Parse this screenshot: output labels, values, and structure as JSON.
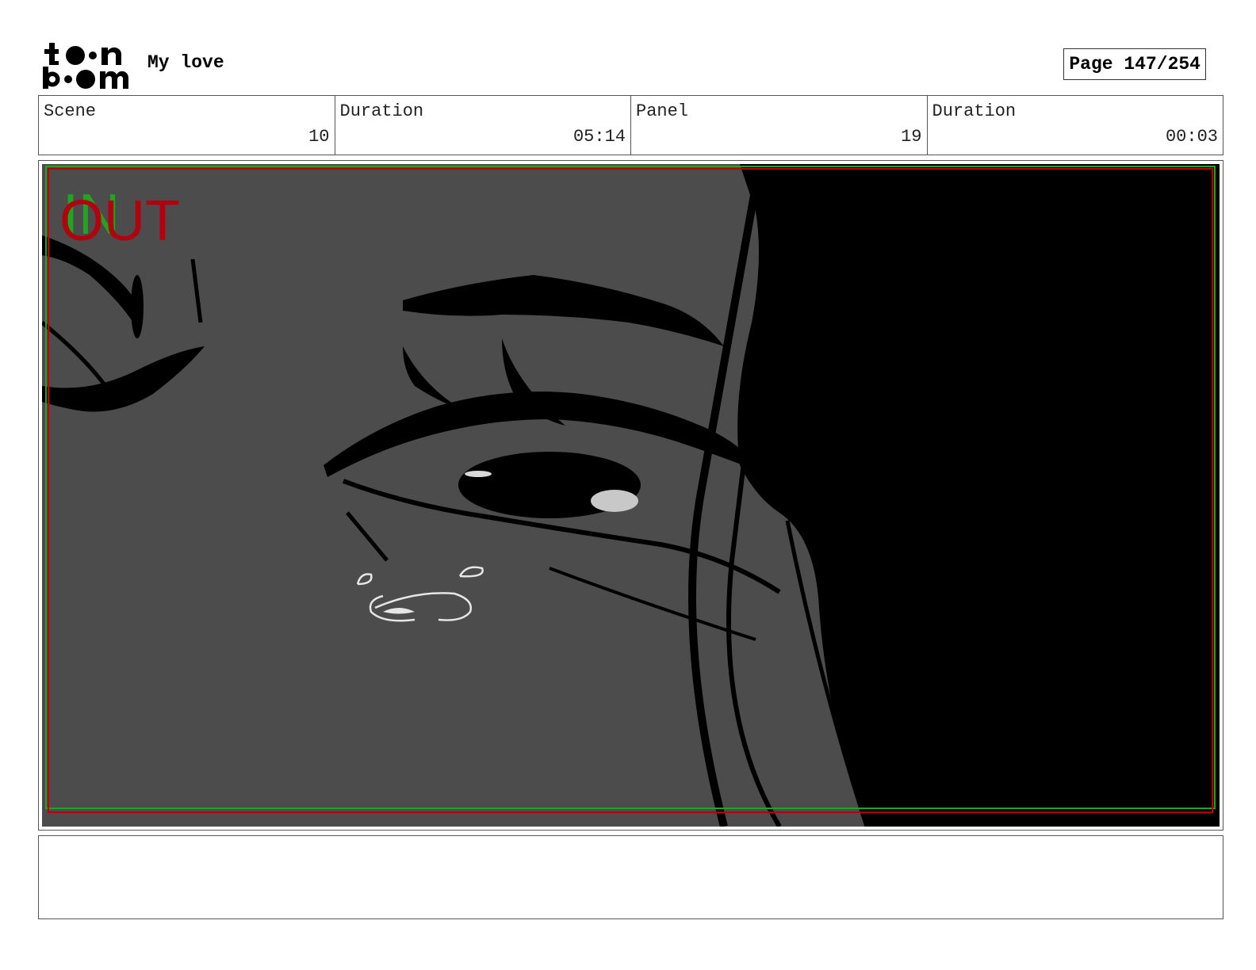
{
  "document": {
    "logo_top": "t••n",
    "logo_bottom": "b••m",
    "title": "My love",
    "page_label": "Page 147/254"
  },
  "info": {
    "scene_label": "Scene",
    "scene_value": "10",
    "scene_duration_label": "Duration",
    "scene_duration_value": "05:14",
    "panel_label": "Panel",
    "panel_value": "19",
    "panel_duration_label": "Duration",
    "panel_duration_value": "00:03"
  },
  "panel": {
    "in_marker": "IN",
    "out_marker": "OUT",
    "colors": {
      "background": "#4c4c4c",
      "ink": "#000000",
      "safe_frame_red": "#b3000f",
      "safe_frame_green": "#1fa51f"
    }
  },
  "notes": {
    "text": ""
  }
}
